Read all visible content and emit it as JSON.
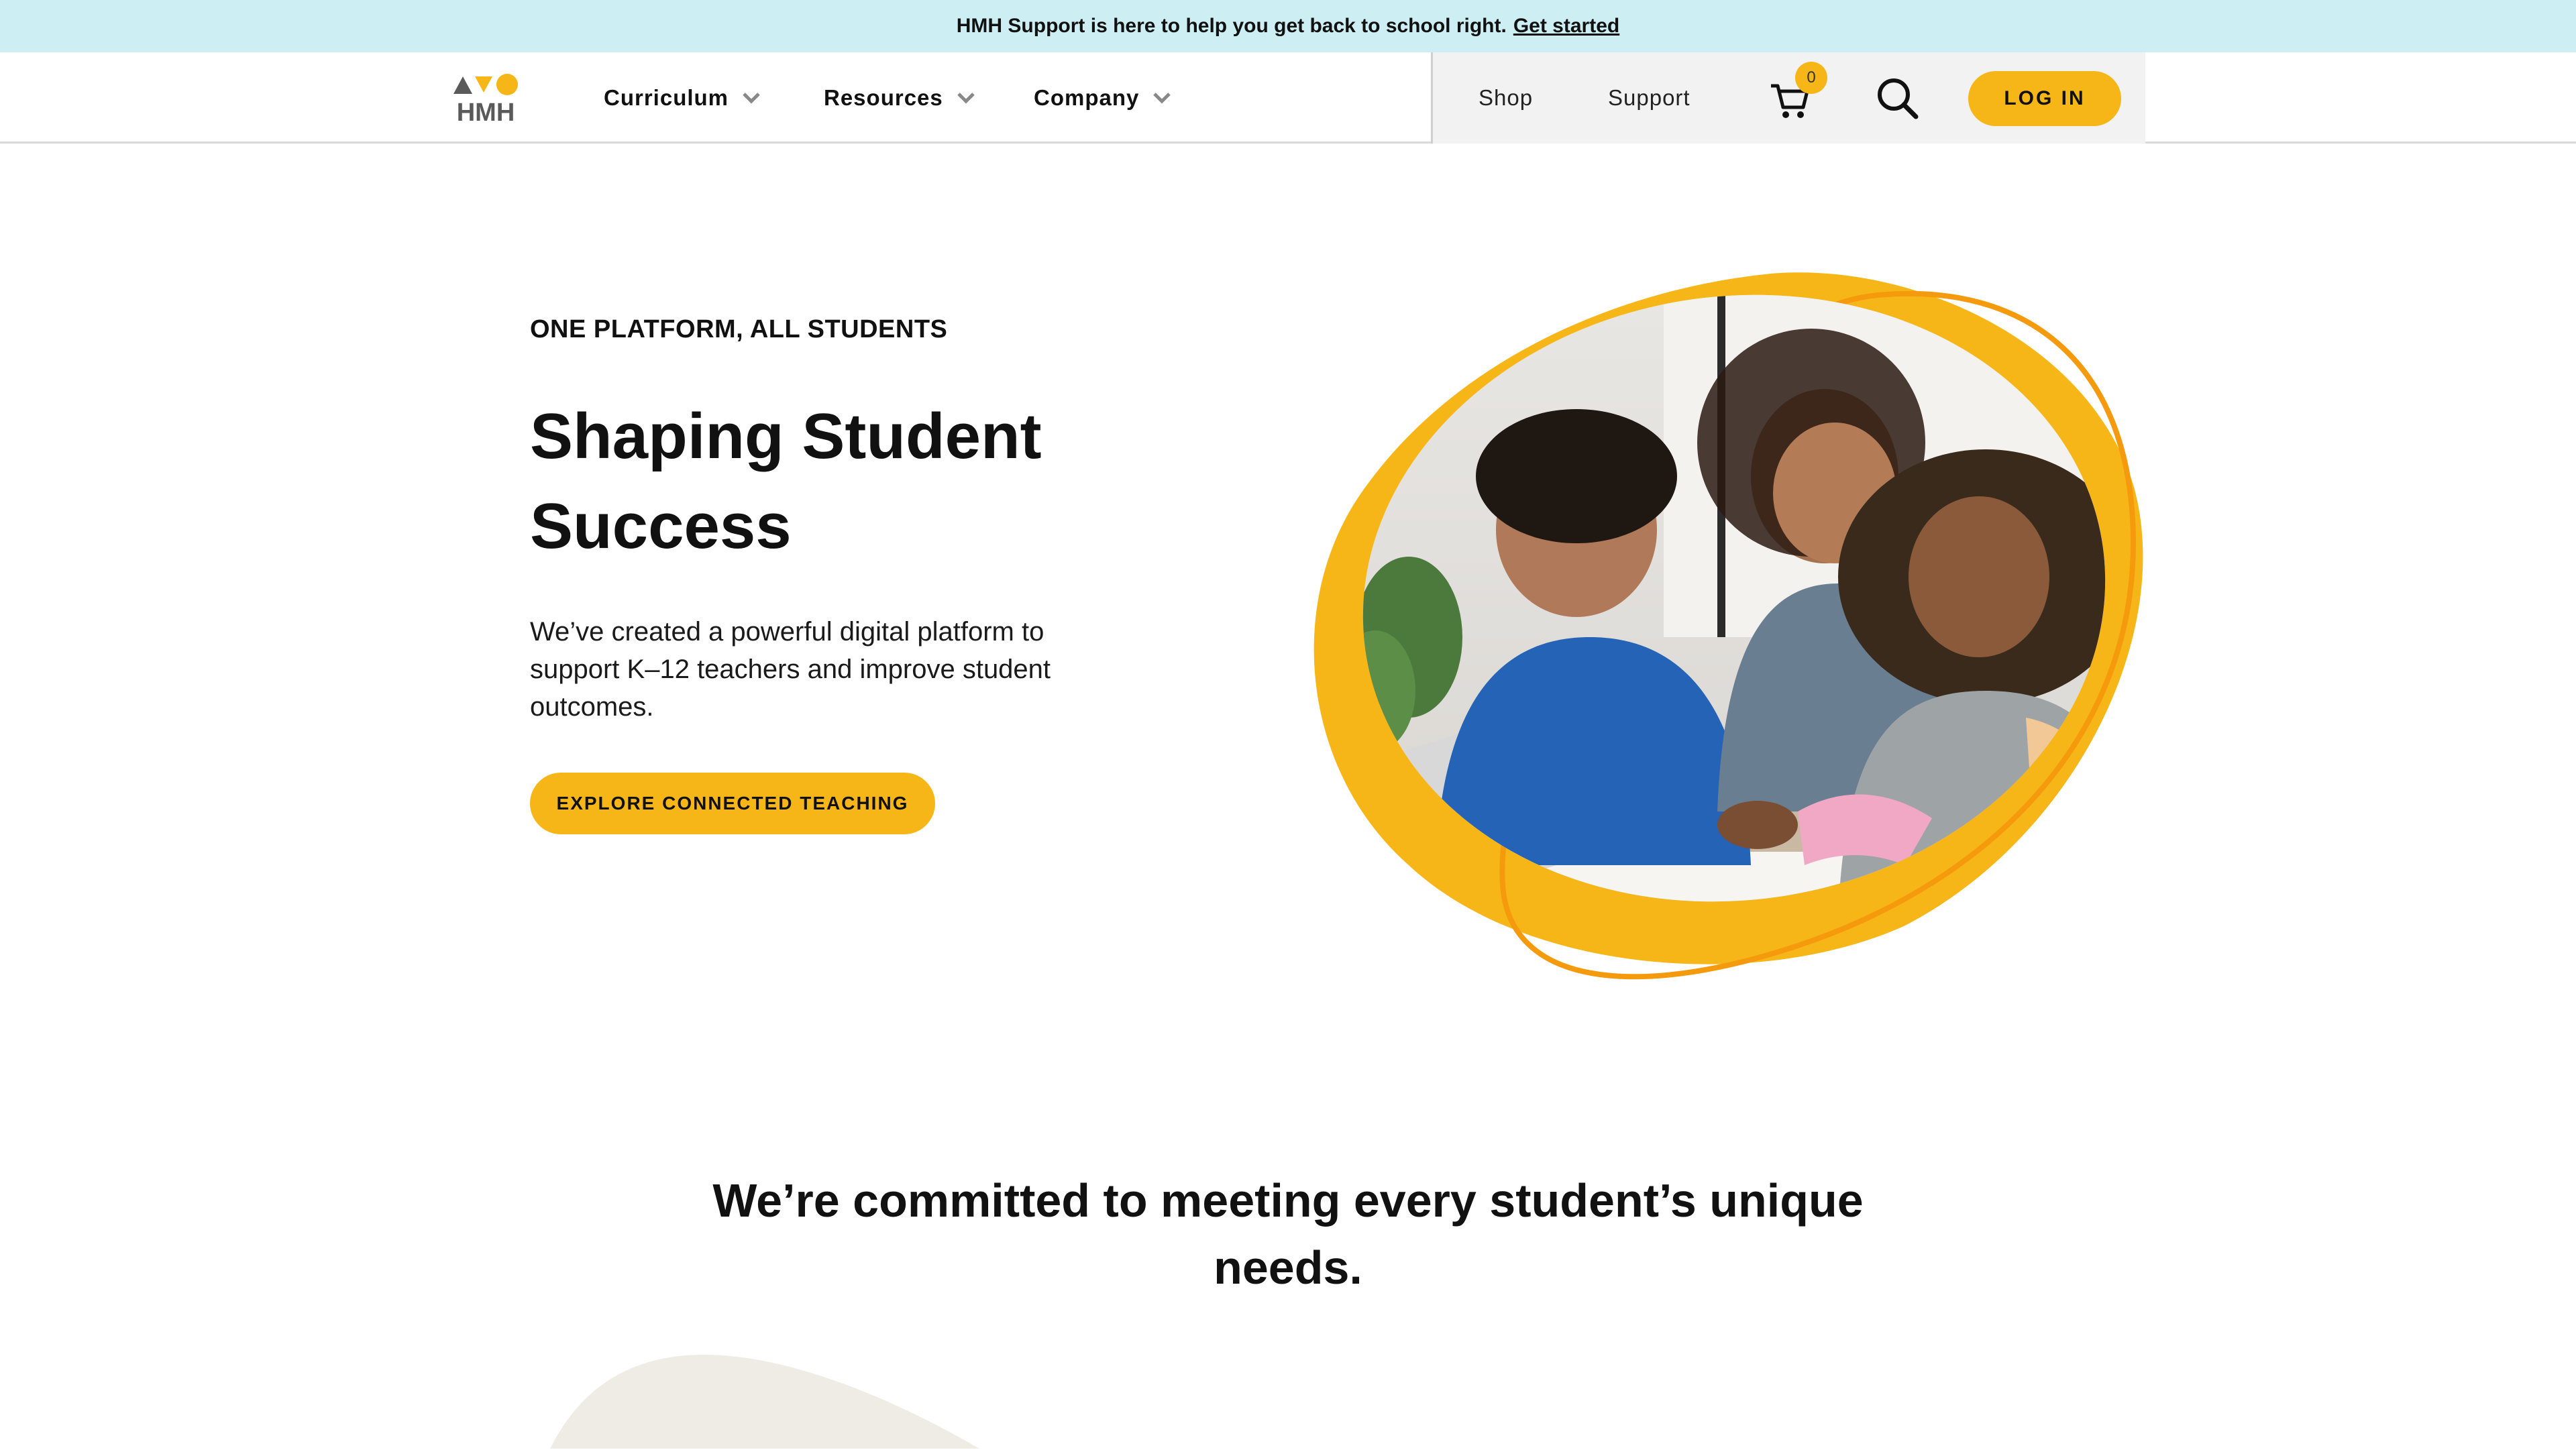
{
  "announcement": {
    "text": "HMH Support is here to help you get back to school right.",
    "link": "Get started"
  },
  "header": {
    "logo_text": "HMH",
    "nav": [
      {
        "label": "Curriculum"
      },
      {
        "label": "Resources"
      },
      {
        "label": "Company"
      }
    ],
    "utility": {
      "shop": "Shop",
      "support": "Support",
      "cart_count": "0",
      "login": "LOG IN"
    }
  },
  "hero": {
    "eyebrow": "ONE PLATFORM, ALL STUDENTS",
    "title": "Shaping Student Success",
    "body": "We’ve created a powerful digital platform to support K–12 teachers and improve student outcomes.",
    "cta": "EXPLORE CONNECTED TEACHING"
  },
  "section": {
    "heading": "We’re committed to meeting every student’s unique needs."
  },
  "colors": {
    "accent": "#f7b617",
    "banner_bg": "#cdeef3"
  }
}
